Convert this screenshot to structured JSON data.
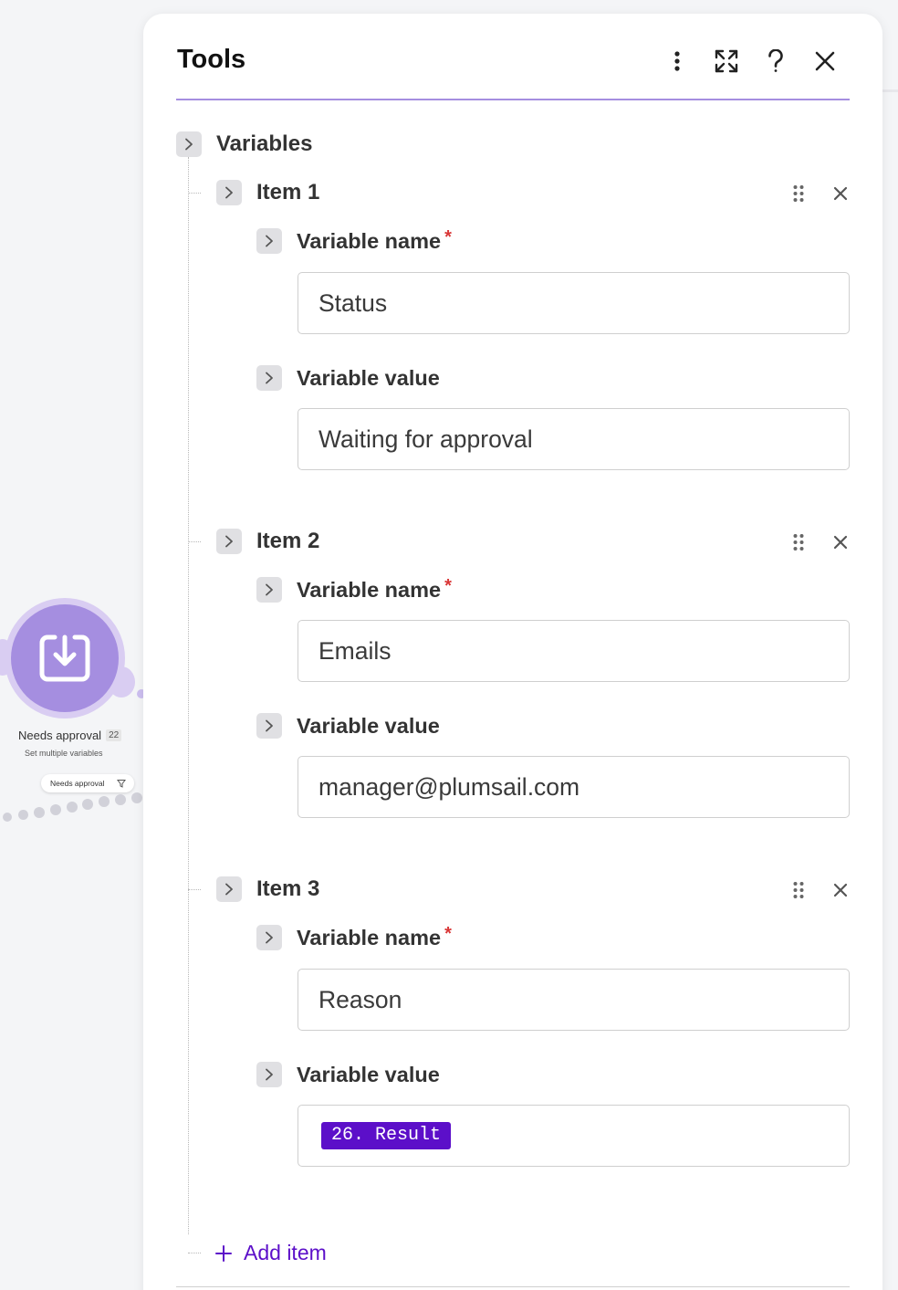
{
  "panel": {
    "title": "Tools",
    "header_actions": [
      "more-options-icon",
      "expand-icon",
      "help-icon",
      "close-icon"
    ]
  },
  "variables": {
    "label": "Variables",
    "items": [
      {
        "label": "Item 1",
        "name_label": "Variable name",
        "name_required": "*",
        "name_value": "Status",
        "value_label": "Variable value",
        "value_value": "Waiting for approval"
      },
      {
        "label": "Item 2",
        "name_label": "Variable name",
        "name_required": "*",
        "name_value": "Emails",
        "value_label": "Variable value",
        "value_value": "manager@plumsail.com"
      },
      {
        "label": "Item 3",
        "name_label": "Variable name",
        "name_required": "*",
        "name_value": "Reason",
        "value_label": "Variable value",
        "value_token": "26. Result"
      }
    ],
    "add_item_label": "Add item"
  },
  "canvas_node": {
    "title": "Needs approval",
    "badge": "22",
    "subtitle": "Set multiple variables",
    "filter_label": "Needs approval"
  },
  "colors": {
    "accent": "#5c0fc9",
    "header_underline": "#a58ee0",
    "node_fill": "#a58ee0",
    "required": "#d93636"
  }
}
